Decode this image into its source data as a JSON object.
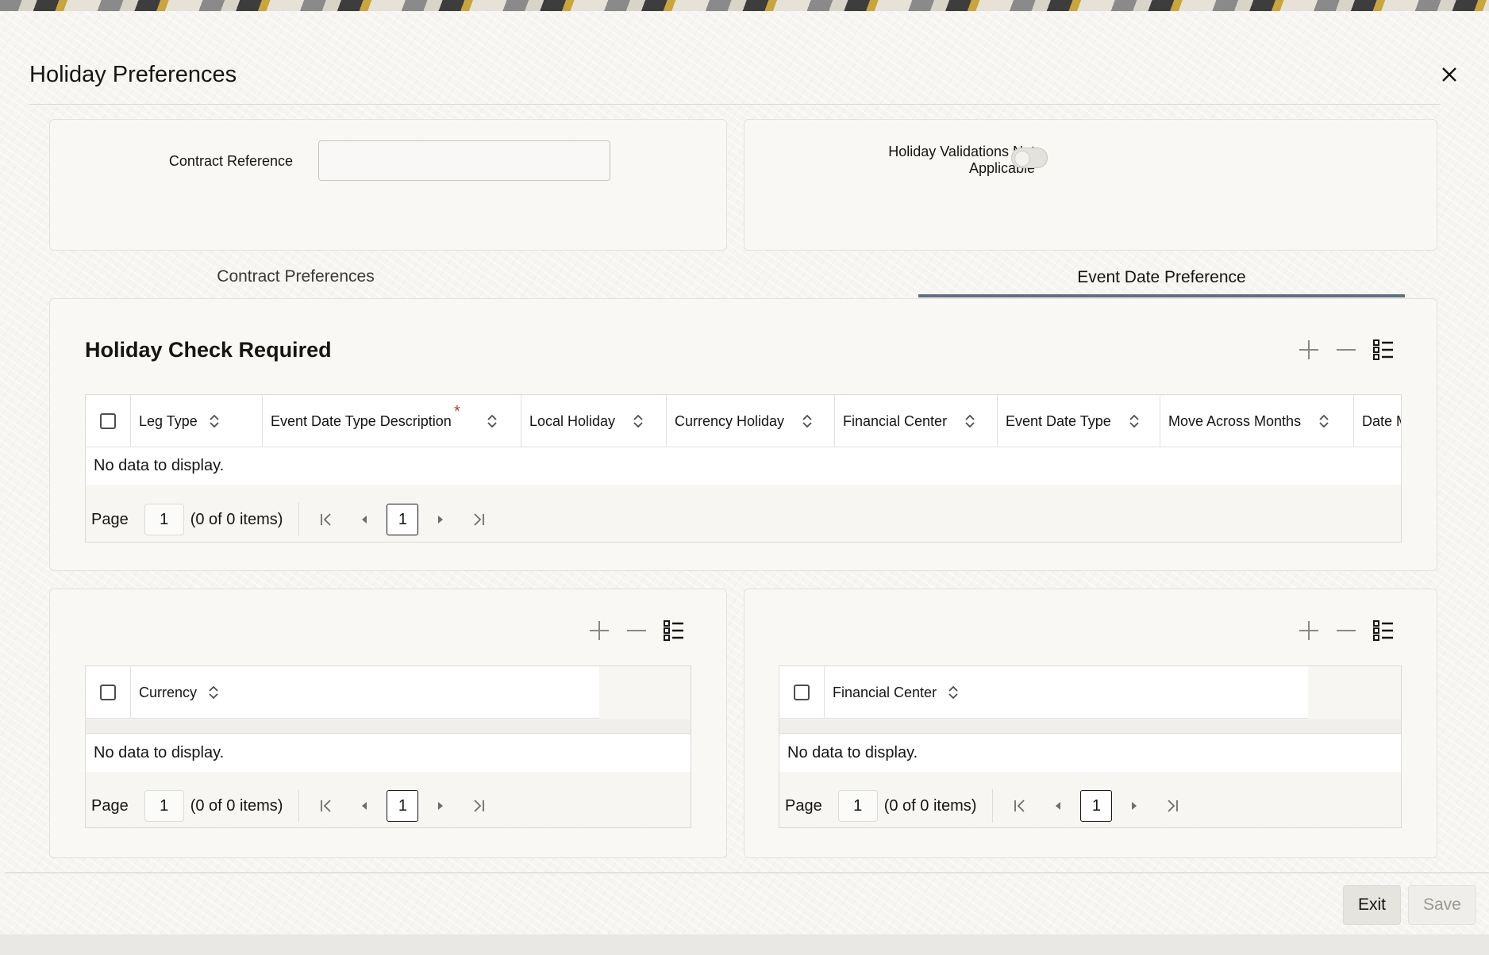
{
  "dialog": {
    "title": "Holiday Preferences"
  },
  "header_fields": {
    "contract_reference_label": "Contract Reference",
    "contract_reference_value": "",
    "holiday_validations_label_line1": "Holiday Validations Not",
    "holiday_validations_label_line2": "Applicable",
    "holiday_validations_on": false
  },
  "tabs": [
    {
      "label": "Contract Preferences",
      "active": false
    },
    {
      "label": "Event Date Preference",
      "active": true
    }
  ],
  "holiday_check": {
    "title": "Holiday Check Required",
    "columns": [
      {
        "label": "Leg Type",
        "required": false
      },
      {
        "label": "Event Date Type Description",
        "required": true
      },
      {
        "label": "Local Holiday",
        "required": false
      },
      {
        "label": "Currency Holiday",
        "required": false
      },
      {
        "label": "Financial Center",
        "required": false
      },
      {
        "label": "Event Date Type",
        "required": false
      },
      {
        "label": "Move Across Months",
        "required": false
      },
      {
        "label": "Date M",
        "required": false
      }
    ],
    "empty_text": "No data to display.",
    "pager": {
      "label": "Page",
      "page": "1",
      "items": "(0 of 0 items)",
      "current": "1"
    }
  },
  "currency_grid": {
    "columns": [
      {
        "label": "Currency"
      }
    ],
    "empty_text": "No data to display.",
    "pager": {
      "label": "Page",
      "page": "1",
      "items": "(0 of 0 items)",
      "current": "1"
    }
  },
  "financial_center_grid": {
    "columns": [
      {
        "label": "Financial Center"
      }
    ],
    "empty_text": "No data to display.",
    "pager": {
      "label": "Page",
      "page": "1",
      "items": "(0 of 0 items)",
      "current": "1"
    }
  },
  "footer": {
    "exit_label": "Exit",
    "save_label": "Save"
  },
  "colors": {
    "tab_underline": "#5f6f82",
    "required_star": "#c0392b",
    "text": "#161513"
  }
}
